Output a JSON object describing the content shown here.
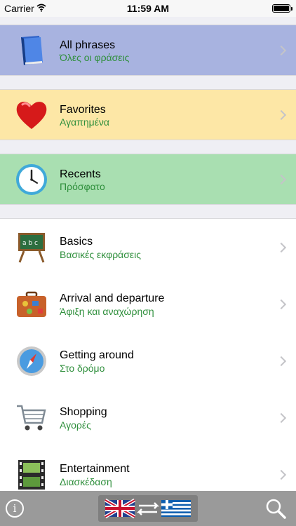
{
  "status_bar": {
    "carrier": "Carrier",
    "time": "11:59 AM",
    "battery_level": 1.0
  },
  "rows": [
    {
      "title": "All phrases",
      "subtitle": "Όλες οι φράσεις",
      "icon": "book-icon",
      "bg": "#a8b3e0"
    },
    {
      "title": "Favorites",
      "subtitle": "Αγαπημένα",
      "icon": "heart-icon",
      "bg": "#fde7a6"
    },
    {
      "title": "Recents",
      "subtitle": "Πρόσφατο",
      "icon": "clock-icon",
      "bg": "#a9dfb1"
    },
    {
      "title": "Basics",
      "subtitle": "Βασικές εκφράσεις",
      "icon": "chalkboard-icon",
      "bg": "#ffffff"
    },
    {
      "title": "Arrival and departure",
      "subtitle": "Άφιξη και αναχώρηση",
      "icon": "suitcase-icon",
      "bg": "#ffffff"
    },
    {
      "title": "Getting around",
      "subtitle": "Στο δρόμο",
      "icon": "compass-icon",
      "bg": "#ffffff"
    },
    {
      "title": "Shopping",
      "subtitle": "Αγορές",
      "icon": "shopping-cart-icon",
      "bg": "#ffffff"
    },
    {
      "title": "Entertainment",
      "subtitle": "Διασκέδαση",
      "icon": "film-icon",
      "bg": "#ffffff"
    }
  ],
  "toolbar": {
    "info_glyph": "i",
    "info_icon": "info-icon",
    "lang_icon": "language-switch-icon",
    "search_icon": "search-icon"
  },
  "colors": {
    "subtitle_green": "#2f8f3c",
    "toolbar_bg": "#9a9a9a"
  }
}
